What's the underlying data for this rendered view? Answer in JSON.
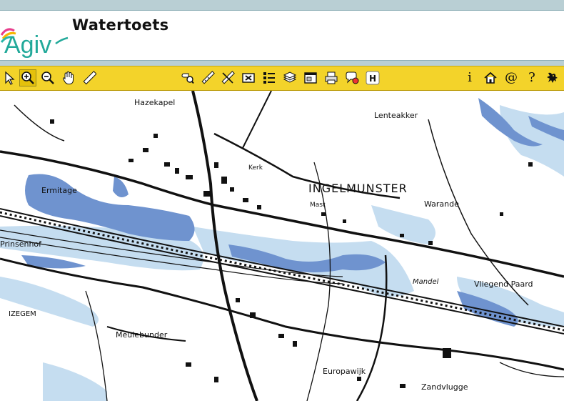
{
  "app": {
    "title": "Watertoets",
    "logo_text": "Agiv"
  },
  "toolbar": {
    "left_tools": [
      "pointer-icon",
      "zoom-in-icon",
      "zoom-out-icon",
      "pan-hand-icon",
      "measure-ruler-icon"
    ],
    "middle_tools": [
      "identify-icon",
      "measure-line-icon",
      "clear-selection-icon",
      "close-box-icon",
      "legend-icon",
      "layers-icon",
      "overview-window-icon",
      "print-icon",
      "map-tips-icon",
      "h-toggle-icon"
    ],
    "right_tools": [
      "info-icon",
      "home-icon",
      "contact-icon",
      "help-icon",
      "flemish-lion-icon"
    ],
    "info_glyph": "i",
    "contact_glyph": "@",
    "help_glyph": "?",
    "h_glyph": "H"
  },
  "map": {
    "labels": [
      {
        "text": "Hazekapel"
      },
      {
        "text": "Lenteakker"
      },
      {
        "text": "INGELMUNSTER"
      },
      {
        "text": "Warande"
      },
      {
        "text": "Ermitage"
      },
      {
        "text": "Prinsenhof"
      },
      {
        "text": "Vliegend Paard"
      },
      {
        "text": "Meulebunder"
      },
      {
        "text": "Europawijk"
      },
      {
        "text": "Zandvlugge"
      },
      {
        "text": "Mandel"
      },
      {
        "text": "IZEGEM"
      },
      {
        "text": "Mast"
      },
      {
        "text": "Kerk"
      }
    ],
    "colors": {
      "flood_dark": "#6f93cf",
      "flood_light": "#c5ddf0",
      "roads": "#111111",
      "background": "#ffffff"
    }
  }
}
